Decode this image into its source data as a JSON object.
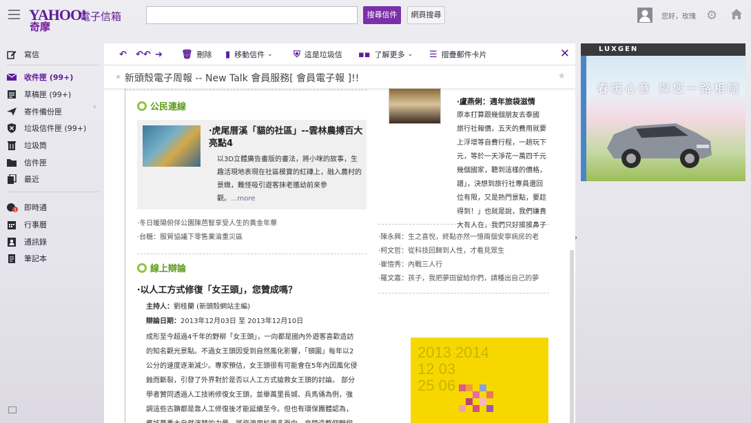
{
  "app": {
    "logo_text": "YAHOO!",
    "logo_sub": "奇摩",
    "mail_title": "電子信箱",
    "search_value": "",
    "search_mail_btn": "搜尋信件",
    "search_web_btn": "網頁搜尋",
    "greeting": "您好，玫瑰"
  },
  "sidebar": {
    "compose": "寫信",
    "folders": [
      {
        "label": "收件匣 (99+)",
        "icon": "envelope-icon"
      },
      {
        "label": "草稿匣 (99+)",
        "icon": "draft-icon"
      },
      {
        "label": "寄件備份匣",
        "icon": "sent-icon"
      },
      {
        "label": "垃圾信件匣 (99+)",
        "icon": "spam-shield-icon"
      },
      {
        "label": "垃圾筒",
        "icon": "trash-icon"
      },
      {
        "label": "信件匣",
        "icon": "folder-icon"
      },
      {
        "label": "最近",
        "icon": "recent-icon"
      }
    ],
    "apps": [
      {
        "label": "即時通",
        "icon": "messenger-icon"
      },
      {
        "label": "行事曆",
        "icon": "calendar-icon"
      },
      {
        "label": "通訊錄",
        "icon": "contacts-icon"
      },
      {
        "label": "筆記本",
        "icon": "notepad-icon"
      }
    ],
    "messenger_badge": "1"
  },
  "toolbar": {
    "delete": "刪除",
    "move": "移動信件",
    "spam": "這是垃圾信",
    "more": "了解更多",
    "stack": "摺疊郵件卡片"
  },
  "email": {
    "subject": "新頭殼電子周報 -- New Talk 會員服務[ 會員電子報 ]!!"
  },
  "newsletter": {
    "section1": "公民連線",
    "card_title": "‧虎尾厝溪「貓的社區」--雲林農搏百大亮點4",
    "card_body": "以3D立體廣告畫版的畫法，將小咪的故事，生趣活現地表現在社區模寶的紅磚上，融入農村的景緻，難怪吸引遊客抹老攜幼前來參觀。",
    "card_more": "...more",
    "links1": [
      "‧冬日暖陽俯佯公園陳芭智享受人生的黃金年華",
      "‧台糖：服貿協議下零售業淪重災區"
    ],
    "section2": "線上辯論",
    "debate_title": "‧以人工方式修復「女王頭」，您贊成嗎？",
    "host_label": "主持人：",
    "host_value": "劉桂蘭 (新頭殼網站主編)",
    "date_label": "辯論日期：",
    "date_value": "2013年12月03日 至 2013年12月10日",
    "debate_body": [
      "成形至今超過4千年的野柳「女王頭」，一向都是國內外遊客喜歡造訪",
      "的知名觀光景點。不過女王頭因受到自然風化影響，「頸圍」每年以2",
      "公分的速度逐漸減少。專家預估，女王頭很有可能會在5年內因風化侵",
      "蝕而斷裂，引發了外界對於是否以人工方式搶救女王頭的討論。 部分",
      "學者贊同透過人工技術修復女王頭，並舉萬里長城、兵馬俑為例，強",
      "調這些古蹟都是靠人工修復後才能延續至今。但也有環保團體認為，",
      "應該尊重大自然演替的力量，將資源用於更多面向，來營造整個野柳"
    ],
    "right_head": "‧盧燕俐：週年旅袋滋情",
    "right_body": [
      "原本打算跟幾個朋友去泰國",
      "旅行社報價，五天的費用就要",
      "上浮增等自費行程，一趟玩下",
      "元，等於一天淨花一萬四千元",
      "幾個國家，聽到這樣的價格，",
      "譜」，決想到旅行社專員還回",
      "位有限，又是熱門景點，要趁",
      "得到！」也就是說，我們嫌貴",
      "大有人在，我們只好摸摸鼻子"
    ],
    "right_links": [
      "‧陳永興：生之喜悅，終點亦然一憶兩個安寧病房的老",
      "‧柯文哲：從科技回歸到人性，才看見眾生",
      "‧崔愷秀：內戰三人行",
      "‧羅文嘉：孩子，我把夢田留給你們，請種出自己的夢"
    ],
    "poster_years": [
      "2013 2014",
      "12    03",
      "25    06"
    ]
  },
  "ad": {
    "brand": "LUXGEN",
    "slogan": "春暖心意  與您一路相隨"
  },
  "colors": {
    "accent": "#5f1a9a",
    "green": "#8cc63f",
    "ad_yellow": "#f6d800"
  }
}
